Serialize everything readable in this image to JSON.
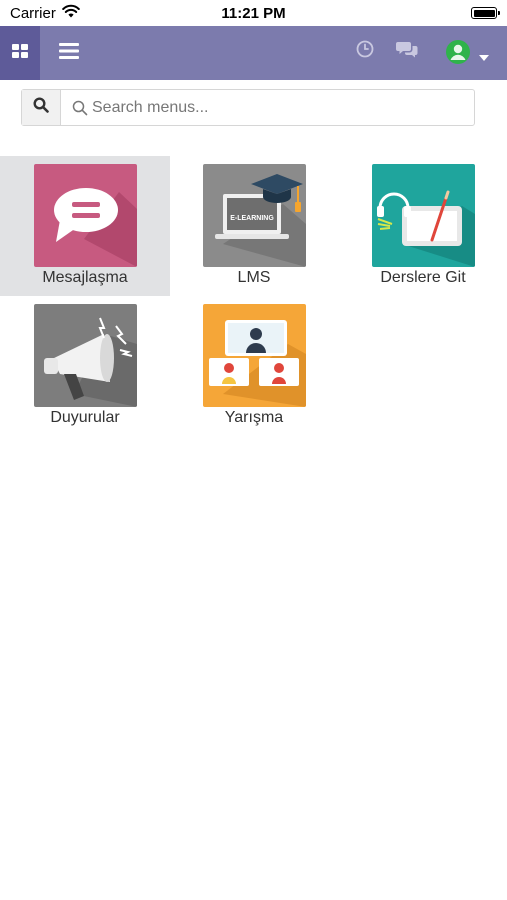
{
  "status_bar": {
    "carrier": "Carrier",
    "time": "11:21 PM"
  },
  "navbar": {
    "background": "#7c7bad",
    "active_background": "#5e5b99",
    "icons": [
      "apps-grid-icon",
      "hamburger-icon",
      "clock-icon",
      "chat-icon",
      "user-avatar-icon",
      "caret-down-icon"
    ]
  },
  "search": {
    "placeholder": "Search menus..."
  },
  "apps": [
    {
      "label": "Mesajlaşma",
      "icon": "chat-bubble-icon",
      "color": "#c75a80",
      "active": true
    },
    {
      "label": "LMS",
      "icon": "elearning-laptop-icon",
      "color": "#8b8b8b"
    },
    {
      "label": "Derslere Git",
      "icon": "tablet-lesson-icon",
      "color": "#1fa59d"
    },
    {
      "label": "Duyurular",
      "icon": "megaphone-icon",
      "color": "#7d7d7d"
    },
    {
      "label": "Yarışma",
      "icon": "competition-icon",
      "color": "#f5a638"
    }
  ],
  "app_icon_texts": {
    "lms_badge": "E-LEARNING"
  }
}
